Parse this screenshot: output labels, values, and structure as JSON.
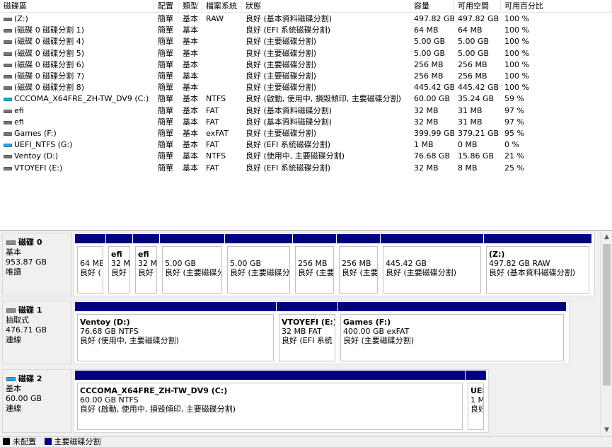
{
  "columns": [
    "磁碟區",
    "配置",
    "類型",
    "檔案系統",
    "狀態",
    "容量",
    "可用空間",
    "可用百分比"
  ],
  "volumes": [
    {
      "name": "(Z:)",
      "layout": "簡單",
      "type": "基本",
      "fs": "RAW",
      "status": "良好 (基本資料磁碟分割)",
      "capacity": "497.82 GB",
      "free": "497.82 GB",
      "pct": "100 %",
      "icon": "drive-icon"
    },
    {
      "name": "(磁碟 0 磁碟分割 1)",
      "layout": "簡單",
      "type": "基本",
      "fs": "",
      "status": "良好 (EFI 系統磁碟分割)",
      "capacity": "64 MB",
      "free": "64 MB",
      "pct": "100 %",
      "icon": "drive-icon"
    },
    {
      "name": "(磁碟 0 磁碟分割 4)",
      "layout": "簡單",
      "type": "基本",
      "fs": "",
      "status": "良好 (主要磁碟分割)",
      "capacity": "5.00 GB",
      "free": "5.00 GB",
      "pct": "100 %",
      "icon": "drive-icon"
    },
    {
      "name": "(磁碟 0 磁碟分割 5)",
      "layout": "簡單",
      "type": "基本",
      "fs": "",
      "status": "良好 (主要磁碟分割)",
      "capacity": "5.00 GB",
      "free": "5.00 GB",
      "pct": "100 %",
      "icon": "drive-icon"
    },
    {
      "name": "(磁碟 0 磁碟分割 6)",
      "layout": "簡單",
      "type": "基本",
      "fs": "",
      "status": "良好 (主要磁碟分割)",
      "capacity": "256 MB",
      "free": "256 MB",
      "pct": "100 %",
      "icon": "drive-icon"
    },
    {
      "name": "(磁碟 0 磁碟分割 7)",
      "layout": "簡單",
      "type": "基本",
      "fs": "",
      "status": "良好 (主要磁碟分割)",
      "capacity": "256 MB",
      "free": "256 MB",
      "pct": "100 %",
      "icon": "drive-icon"
    },
    {
      "name": "(磁碟 0 磁碟分割 8)",
      "layout": "簡單",
      "type": "基本",
      "fs": "",
      "status": "良好 (主要磁碟分割)",
      "capacity": "445.42 GB",
      "free": "445.42 GB",
      "pct": "100 %",
      "icon": "drive-icon"
    },
    {
      "name": "CCCOMA_X64FRE_ZH-TW_DV9 (C:)",
      "layout": "簡單",
      "type": "基本",
      "fs": "NTFS",
      "status": "良好 (啟動, 使用中, 損毀傾印, 主要磁碟分割)",
      "capacity": "60.00 GB",
      "free": "35.24 GB",
      "pct": "59 %",
      "icon": "system-drive-icon"
    },
    {
      "name": "efi",
      "layout": "簡單",
      "type": "基本",
      "fs": "FAT",
      "status": "良好 (基本資料磁碟分割)",
      "capacity": "32 MB",
      "free": "31 MB",
      "pct": "97 %",
      "icon": "drive-icon"
    },
    {
      "name": "efi",
      "layout": "簡單",
      "type": "基本",
      "fs": "FAT",
      "status": "良好 (基本資料磁碟分割)",
      "capacity": "32 MB",
      "free": "31 MB",
      "pct": "97 %",
      "icon": "drive-icon"
    },
    {
      "name": "Games (F:)",
      "layout": "簡單",
      "type": "基本",
      "fs": "exFAT",
      "status": "良好 (主要磁碟分割)",
      "capacity": "399.99 GB",
      "free": "379.21 GB",
      "pct": "95 %",
      "icon": "drive-icon"
    },
    {
      "name": "UEFI_NTFS (G:)",
      "layout": "簡單",
      "type": "基本",
      "fs": "FAT",
      "status": "良好 (EFI 系統磁碟分割)",
      "capacity": "1 MB",
      "free": "0 MB",
      "pct": "0 %",
      "icon": "system-drive-icon"
    },
    {
      "name": "Ventoy (D:)",
      "layout": "簡單",
      "type": "基本",
      "fs": "NTFS",
      "status": "良好 (使用中, 主要磁碟分割)",
      "capacity": "76.68 GB",
      "free": "15.86 GB",
      "pct": "21 %",
      "icon": "drive-icon"
    },
    {
      "name": "VTOYEFI (E:)",
      "layout": "簡單",
      "type": "基本",
      "fs": "FAT",
      "status": "良好 (EFI 系統磁碟分割)",
      "capacity": "32 MB",
      "free": "8 MB",
      "pct": "25 %",
      "icon": "drive-icon"
    }
  ],
  "disks": [
    {
      "title": "磁碟 0",
      "type": "基本",
      "size": "953.87 GB",
      "state": "唯讀",
      "icon": "disk-icon",
      "partitions": [
        {
          "name": "",
          "size": "64 MB",
          "status": "良好 ("
        },
        {
          "name": "efi",
          "size": "32 MB",
          "status": "良好"
        },
        {
          "name": "efi",
          "size": "32 MB",
          "status": "良好"
        },
        {
          "name": "",
          "size": "5.00 GB",
          "status": "良好 (主要磁碟分割)"
        },
        {
          "name": "",
          "size": "5.00 GB",
          "status": "良好 (主要磁碟分割)"
        },
        {
          "name": "",
          "size": "256 MB",
          "status": "良好 (主要"
        },
        {
          "name": "",
          "size": "256 MB",
          "status": "良好 (主要"
        },
        {
          "name": "",
          "size": "445.42 GB",
          "status": "良好 (主要磁碟分割)"
        },
        {
          "name": "(Z:)",
          "size": "497.82 GB RAW",
          "status": "良好 (基本資料磁碟分割)"
        }
      ]
    },
    {
      "title": "磁碟 1",
      "type": "抽取式",
      "size": "476.71 GB",
      "state": "連線",
      "icon": "disk-icon",
      "partitions": [
        {
          "name": "Ventoy  (D:)",
          "size": "76.68 GB NTFS",
          "status": "良好 (使用中, 主要磁碟分割)"
        },
        {
          "name": "VTOYEFI  (E:)",
          "size": "32 MB FAT",
          "status": "良好 (EFI 系統"
        },
        {
          "name": "Games  (F:)",
          "size": "400.00 GB exFAT",
          "status": "良好 (主要磁碟分割)"
        }
      ]
    },
    {
      "title": "磁碟 2",
      "type": "基本",
      "size": "60.00 GB",
      "state": "連線",
      "icon": "ssd-disk-icon",
      "partitions": [
        {
          "name": "CCCOMA_X64FRE_ZH-TW_DV9  (C:)",
          "size": "60.00 GB NTFS",
          "status": "良好 (啟動, 使用中, 損毀傾印, 主要磁碟分割)"
        },
        {
          "name": "UEF",
          "size": "1 M",
          "status": "良好"
        }
      ]
    }
  ],
  "legend": [
    {
      "label": "未配置",
      "color": "#000000"
    },
    {
      "label": "主要磁碟分割",
      "color": "#000080"
    }
  ],
  "scroll": {
    "up": "▲",
    "down": "▼"
  }
}
